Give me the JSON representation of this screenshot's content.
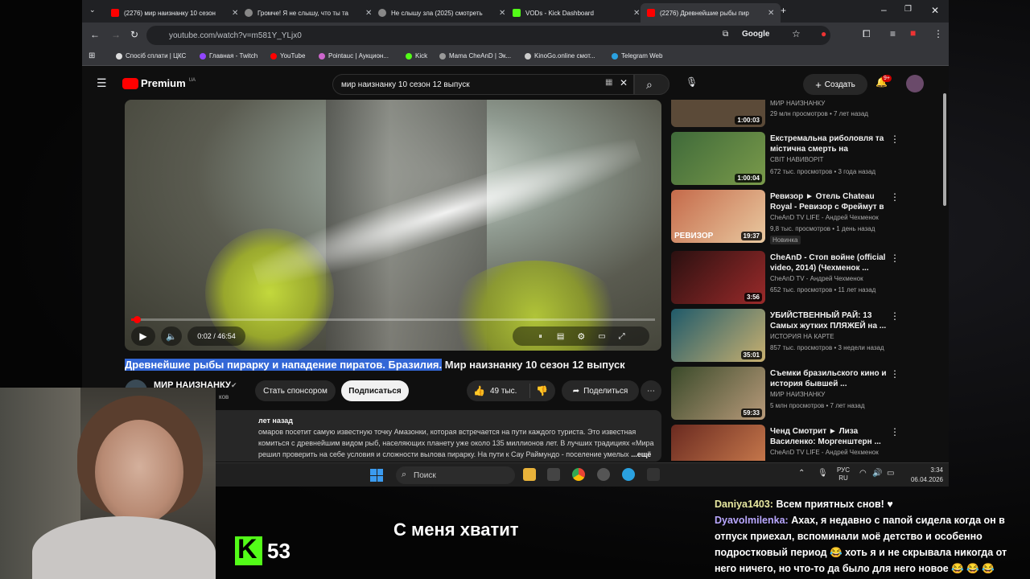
{
  "browser": {
    "tabs": [
      {
        "label": "(2276) мир наизнанку 10 сезон",
        "active": false
      },
      {
        "label": "Громче! Я не слышу, что ты та",
        "active": false
      },
      {
        "label": "Не слышу зла (2025) смотреть",
        "active": false
      },
      {
        "label": "VODs - Kick Dashboard",
        "active": false
      },
      {
        "label": "(2276) Древнейшие рыбы пир",
        "active": true
      }
    ],
    "url": "youtube.com/watch?v=m581Y_YLjx0",
    "profile_label": "Google",
    "bookmarks": [
      "Спосіб сплати | ЦКС",
      "Главная - Twitch",
      "YouTube",
      "Pointauc | Аукцион...",
      "Kick",
      "Mama CheAnD | Эк...",
      "KinoGo.online смот...",
      "Telegram Web"
    ]
  },
  "youtube": {
    "logo": "Premium",
    "region": "UA",
    "search_query": "мир наизнанку 10 сезон 12 выпуск",
    "create_label": "Создать",
    "notif_count": "9+",
    "player": {
      "time": "0:02 / 46:54",
      "progress": 0.01
    },
    "title_highlighted": "Древнейшие рыбы пирарку и нападение пиратов. Бразилия.",
    "title_rest": " Мир наизнанку 10 сезон 12 выпуск",
    "channel": "МИР НАИЗНАНКУ",
    "subs_partial": "ков",
    "sponsor_label": "Стать спонсором",
    "subscribe_label": "Подписаться",
    "likes": "49 тыс.",
    "share_label": "Поделиться",
    "desc": {
      "date": "лет назад",
      "line1": "омаров посетит самую известную точку Амазонки, которая встречается на пути каждого туриста. Это известная",
      "line2": "комиться с древнейшим видом рыб, населяющих планету уже около 135 миллионов лет. В лучших традициях «Мира",
      "line3": "решил проверить на себе условия и сложности вылова пирарку. На пути к Сау Раймундо - поселение умелых",
      "more": "...ещё"
    },
    "recs": [
      {
        "title": "",
        "channel": "МИР НАИЗНАНКУ",
        "meta": "29 млн просмотров • 7 лет назад",
        "duration": "1:00:03",
        "thumb": "#5b4a38",
        "new": ""
      },
      {
        "title": "Екстремальна риболовля та містична смерть на Амазонці...",
        "channel": "СВІТ НАВИВОРІТ",
        "meta": "672 тыс. просмотров • 3 года назад",
        "duration": "1:00:04",
        "thumb": "#3f6a3a",
        "new": ""
      },
      {
        "title": "Ревизор ► Отель Chateau Royal - Ревизор с Фреймут в ...",
        "channel": "CheAnD TV LIFE - Андрей Чехменок",
        "meta": "9,8 тыс. просмотров • 1 день назад",
        "duration": "19:37",
        "thumb": "#b0453a",
        "new": "Новинка"
      },
      {
        "title": "CheAnD - Стоп войне (official video, 2014) (Чехменок ...",
        "channel": "CheAnD TV - Андрей Чехменок",
        "meta": "652 тыс. просмотров • 11 лет назад",
        "duration": "3:56",
        "thumb": "#7a1a1a",
        "new": ""
      },
      {
        "title": "УБИЙСТВЕННЫЙ РАЙ: 13 Самых жутких ПЛЯЖЕЙ на ...",
        "channel": "ИСТОРИЯ НА КАРТЕ",
        "meta": "857 тыс. просмотров • 3 недели назад",
        "duration": "35:01",
        "thumb": "#2c6f7a",
        "new": ""
      },
      {
        "title": "Съемки бразильского кино и история бывшей ...",
        "channel": "МИР НАИЗНАНКУ",
        "meta": "5 млн просмотров • 7 лет назад",
        "duration": "59:33",
        "thumb": "#4a5a3a",
        "new": ""
      },
      {
        "title": "Ченд Смотрит ► Лиза Василенко: Моргенштерн ...",
        "channel": "CheAnD TV LIFE - Андрей Чехменок",
        "meta": "",
        "duration": "",
        "thumb": "#7a3a30",
        "new": ""
      }
    ]
  },
  "taskbar": {
    "search_placeholder": "Поиск",
    "lang1": "РУС",
    "lang2": "RU",
    "time": "3:34",
    "date": "06.04.2026"
  },
  "stream": {
    "viewers": "53",
    "caption": "С меня хватит",
    "chat": [
      {
        "user": "Daniya1403:",
        "text": " Всем приятных снов! ♥"
      },
      {
        "user": "Dyavolmilenka:",
        "text": " Ахах, я недавно с папой сидела когда он в отпуск приехал, вспоминали моё детство и особенно подростковый период 😂 хоть я и не скрывала никогда от него ничего, но что-то да было для него новое 😂 😂 😂"
      }
    ]
  }
}
